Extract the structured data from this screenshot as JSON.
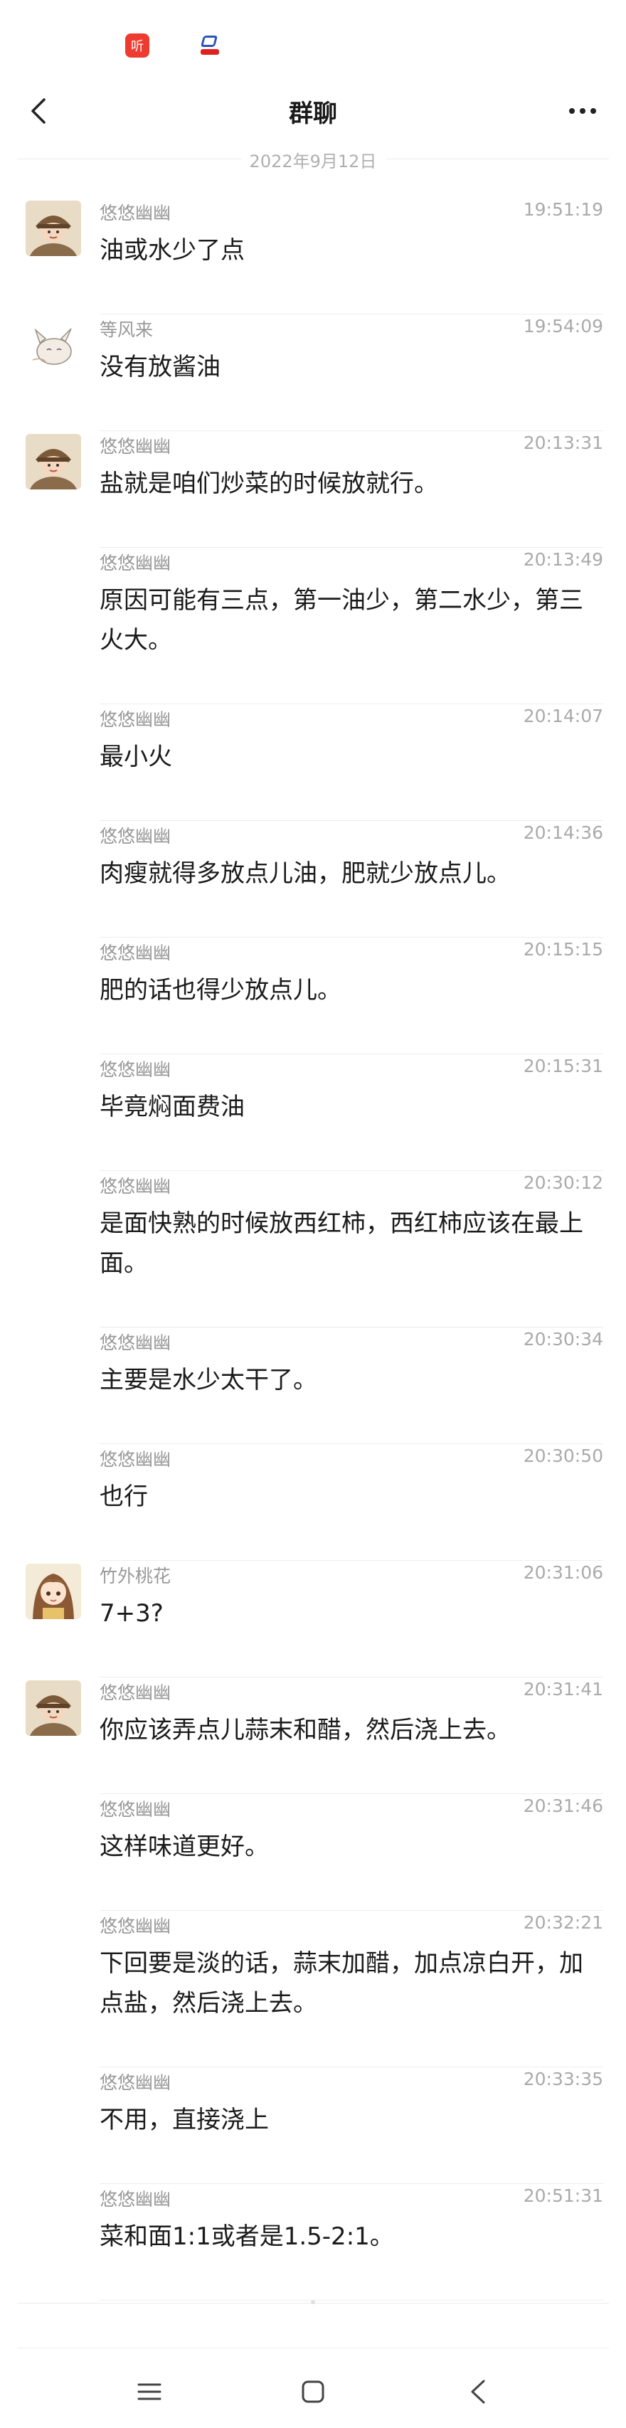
{
  "status_bar": {
    "icons": [
      {
        "name": "listen-app-icon",
        "glyph": "听",
        "color": "#ee3b2f"
      },
      {
        "name": "news-app-icon",
        "color": "#2a54b8"
      }
    ]
  },
  "header": {
    "title": "群聊",
    "back_icon": "chevron-left-icon",
    "more_icon": "more-dots-icon"
  },
  "date_divider": "2022年9月12日",
  "messages": [
    {
      "sender": "悠悠幽幽",
      "time": "19:51:19",
      "text": "油或水少了点",
      "avatar": "girl-hat-avatar"
    },
    {
      "sender": "等风来",
      "time": "19:54:09",
      "text": "没有放酱油",
      "avatar": "cat-sketch-avatar"
    },
    {
      "sender": "悠悠幽幽",
      "time": "20:13:31",
      "text": "盐就是咱们炒菜的时候放就行。",
      "avatar": "girl-hat-avatar"
    },
    {
      "sender": "悠悠幽幽",
      "time": "20:13:49",
      "text": "原因可能有三点，第一油少，第二水少，第三火大。"
    },
    {
      "sender": "悠悠幽幽",
      "time": "20:14:07",
      "text": "最小火"
    },
    {
      "sender": "悠悠幽幽",
      "time": "20:14:36",
      "text": "肉瘦就得多放点儿油，肥就少放点儿。"
    },
    {
      "sender": "悠悠幽幽",
      "time": "20:15:15",
      "text": "肥的话也得少放点儿。"
    },
    {
      "sender": "悠悠幽幽",
      "time": "20:15:31",
      "text": "毕竟焖面费油"
    },
    {
      "sender": "悠悠幽幽",
      "time": "20:30:12",
      "text": "是面快熟的时候放西红柿，西红柿应该在最上面。"
    },
    {
      "sender": "悠悠幽幽",
      "time": "20:30:34",
      "text": "主要是水少太干了。"
    },
    {
      "sender": "悠悠幽幽",
      "time": "20:30:50",
      "text": "也行"
    },
    {
      "sender": "竹外桃花",
      "time": "20:31:06",
      "text": "7+3?",
      "avatar": "anime-girl-avatar"
    },
    {
      "sender": "悠悠幽幽",
      "time": "20:31:41",
      "text": "你应该弄点儿蒜末和醋，然后浇上去。",
      "avatar": "girl-hat-avatar"
    },
    {
      "sender": "悠悠幽幽",
      "time": "20:31:46",
      "text": "这样味道更好。"
    },
    {
      "sender": "悠悠幽幽",
      "time": "20:32:21",
      "text": "下回要是淡的话，蒜末加醋，加点凉白开，加点盐，然后浇上去。"
    },
    {
      "sender": "悠悠幽幽",
      "time": "20:33:35",
      "text": "不用，直接浇上"
    },
    {
      "sender": "悠悠幽幽",
      "time": "20:51:31",
      "text": "菜和面1:1或者是1.5-2:1。"
    }
  ],
  "system_nav": {
    "menu_icon": "menu-icon",
    "home_icon": "home-square-icon",
    "back_icon": "back-triangle-icon"
  },
  "colors": {
    "background": "#ffffff",
    "meta_text": "#999999",
    "message_text": "#1b1b1b",
    "divider": "#ededed"
  }
}
